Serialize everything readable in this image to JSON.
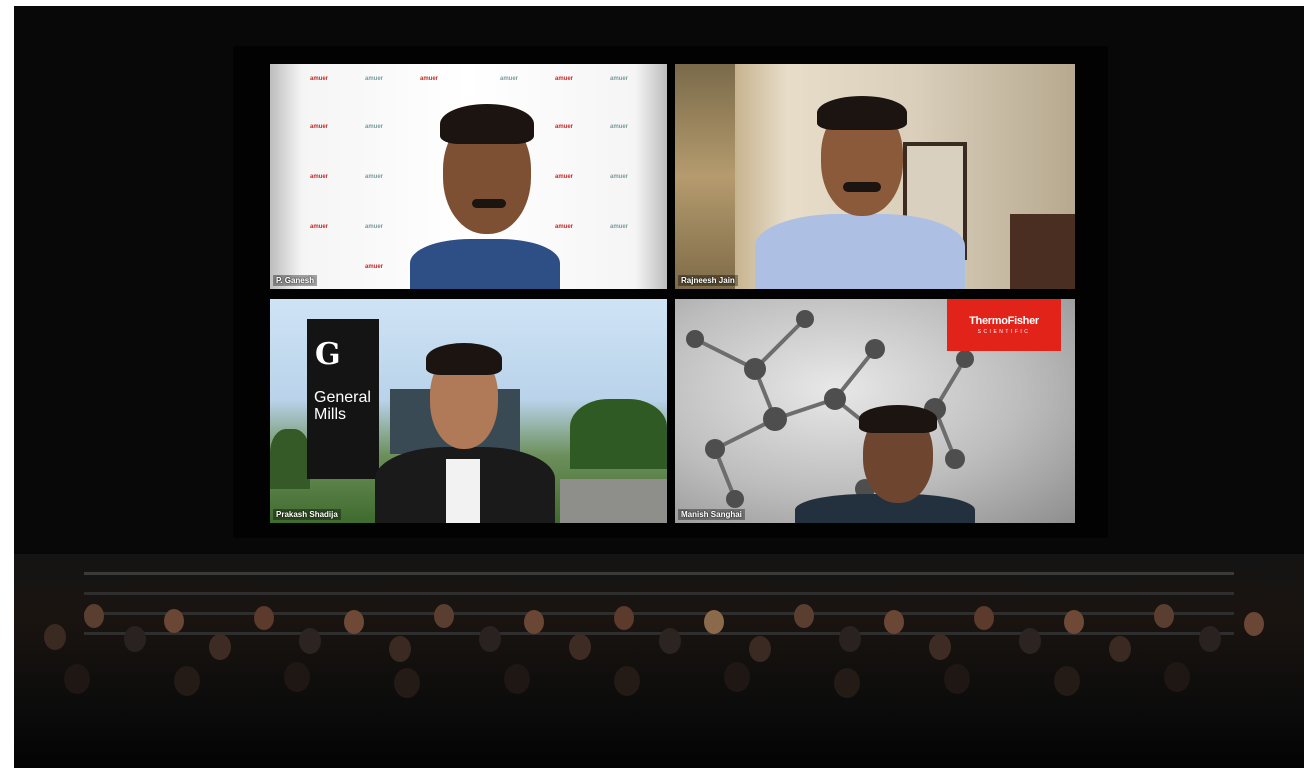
{
  "participants": [
    {
      "name": "P. Ganesh",
      "backdrop_text": "amuer"
    },
    {
      "name": "Rajneesh Jain"
    },
    {
      "name": "Prakash Shadija",
      "sign_text_top": "General",
      "sign_text_bottom": "Mills",
      "sign_logo": "G"
    },
    {
      "name": "Manish Sanghai",
      "logo_text": "ThermoFisher",
      "logo_subtext": "SCIENTIFIC"
    }
  ],
  "colors": {
    "background": "#080808",
    "accent_red": "#e2231a"
  }
}
